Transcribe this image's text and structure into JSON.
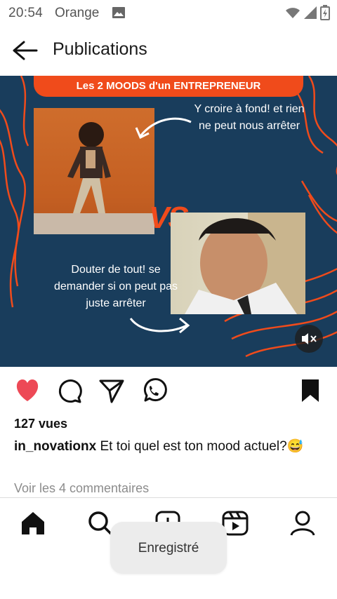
{
  "status": {
    "time": "20:54",
    "carrier": "Orange"
  },
  "header": {
    "title": "Publications"
  },
  "post": {
    "banner": "Les 2 MOODS d'un ENTREPRENEUR",
    "vs_label": "VS",
    "quote_top": "Y croire à fond! et rien ne peut nous arrêter",
    "quote_bottom": "Douter de tout! se demander si on peut pas juste arrêter",
    "colors": {
      "background": "#193d5c",
      "accent": "#f04b1b"
    }
  },
  "actions": {
    "liked": true,
    "saved": true
  },
  "stats": {
    "views": "127 vues"
  },
  "caption": {
    "username": "in_novationx",
    "text": " Et toi quel est ton mood actuel?😅"
  },
  "comments": {
    "link": "Voir les 4 commentaires"
  },
  "toast": {
    "message": "Enregistré"
  },
  "colors": {
    "like": "#ed4956",
    "text": "#111111",
    "muted": "#8c8c8c"
  }
}
